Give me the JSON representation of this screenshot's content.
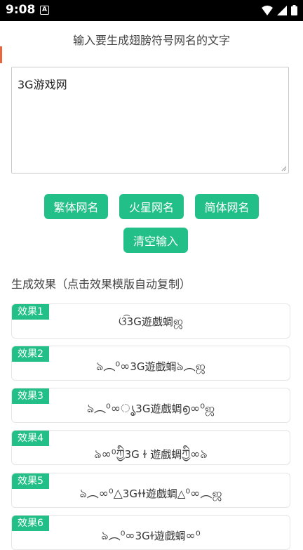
{
  "status_bar": {
    "time": "9:08",
    "a_label": "A"
  },
  "prompt_label": "输入要生成翅膀符号网名的文字",
  "input": {
    "value": "3G游戏网"
  },
  "buttons": {
    "traditional": "繁体网名",
    "martian": "火星网名",
    "simplified": "简体网名",
    "clear": "清空输入"
  },
  "results_title": "生成效果（点击效果模版自动复制）",
  "results": [
    {
      "tag": "效果1",
      "left": "ଓ͡",
      "core": "3G遊戲蜩",
      "right": "ஜ"
    },
    {
      "tag": "效果2",
      "left": "ঌ︵⁰∞",
      "core": "3G遊戲蜩",
      "right": "ঌ︵ஜ"
    },
    {
      "tag": "效果3",
      "left": "ঌ︵⁰∞ൃ",
      "core": "3G遊戲蜩",
      "right": "൭∞⁰ஜ"
    },
    {
      "tag": "效果4",
      "left": "ঌ∞⁰ཀྱི",
      "core": "3G ɫ 遊戲蜩",
      "right": "ཀྱི∞ঌ"
    },
    {
      "tag": "效果5",
      "left": "ঌ︵∞⁰△",
      "core": "3Gɫɫ遊戲蜩△",
      "right": "⁰∞︵ஜ"
    },
    {
      "tag": "效果6",
      "left": "ঌ︵⁰∞",
      "core": "3Gɫ遊戲蜩",
      "right": "∞⁰"
    }
  ]
}
